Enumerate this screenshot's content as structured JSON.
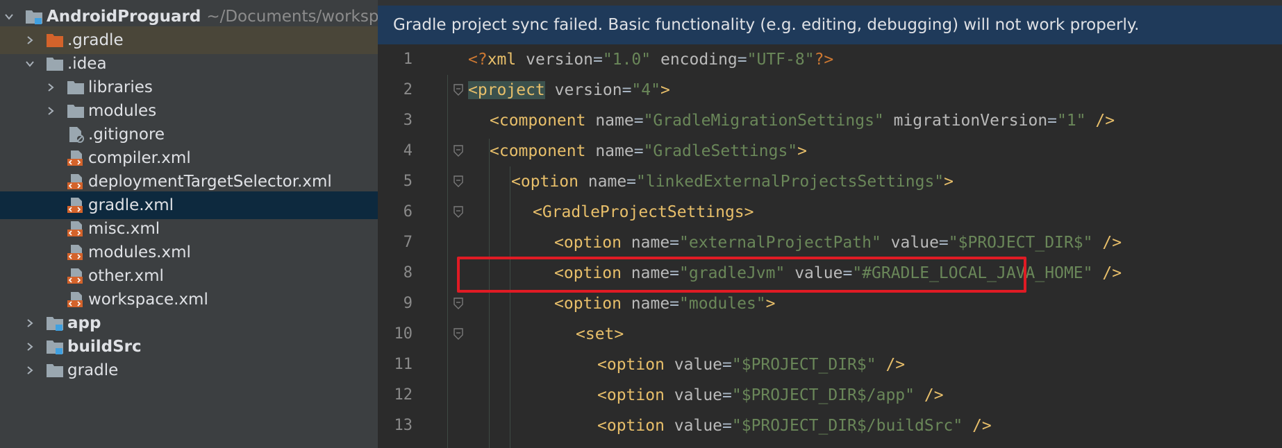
{
  "sidebar": {
    "items": [
      {
        "label": "AndroidProguard",
        "path": "~/Documents/worksp",
        "icon": "project-folder-icon",
        "arrow": "chevron-down-icon"
      },
      {
        "label": ".gradle",
        "icon": "orange-folder-icon",
        "arrow": "chevron-right-icon"
      },
      {
        "label": ".idea",
        "icon": "folder-icon",
        "arrow": "chevron-down-icon"
      },
      {
        "label": "libraries",
        "icon": "folder-icon",
        "arrow": "chevron-right-icon"
      },
      {
        "label": "modules",
        "icon": "folder-icon",
        "arrow": "chevron-right-icon"
      },
      {
        "label": ".gitignore",
        "icon": "ignored-file-icon"
      },
      {
        "label": "compiler.xml",
        "icon": "xml-file-icon"
      },
      {
        "label": "deploymentTargetSelector.xml",
        "icon": "xml-file-icon"
      },
      {
        "label": "gradle.xml",
        "icon": "xml-file-icon"
      },
      {
        "label": "misc.xml",
        "icon": "xml-file-icon"
      },
      {
        "label": "modules.xml",
        "icon": "xml-file-icon"
      },
      {
        "label": "other.xml",
        "icon": "xml-file-icon"
      },
      {
        "label": "workspace.xml",
        "icon": "xml-file-icon"
      },
      {
        "label": "app",
        "icon": "module-folder-icon",
        "arrow": "chevron-right-icon"
      },
      {
        "label": "buildSrc",
        "icon": "module-folder-icon",
        "arrow": "chevron-right-icon"
      },
      {
        "label": "gradle",
        "icon": "folder-icon",
        "arrow": "chevron-right-icon"
      }
    ]
  },
  "editor": {
    "banner": "Gradle project sync failed. Basic functionality (e.g. editing, debugging) will not work properly.",
    "lines": [
      {
        "num": "1",
        "tokens": [
          [
            "pi",
            "<?"
          ],
          [
            "tg",
            "xml "
          ],
          [
            "at",
            "version"
          ],
          [
            "tx",
            "="
          ],
          [
            "va",
            "\"1.0\""
          ],
          [
            "at",
            " encoding"
          ],
          [
            "tx",
            "="
          ],
          [
            "va",
            "\"UTF-8\""
          ],
          [
            "pi",
            "?>"
          ]
        ]
      },
      {
        "num": "2",
        "tokens": [
          [
            "tgh",
            "<project"
          ],
          [
            "at",
            " version"
          ],
          [
            "tx",
            "="
          ],
          [
            "va",
            "\"4\""
          ],
          [
            "tg",
            ">"
          ]
        ]
      },
      {
        "num": "3",
        "tokens": [
          [
            "tg",
            "<component "
          ],
          [
            "at",
            "name"
          ],
          [
            "tx",
            "="
          ],
          [
            "va",
            "\"GradleMigrationSettings\""
          ],
          [
            "at",
            " migrationVersion"
          ],
          [
            "tx",
            "="
          ],
          [
            "va",
            "\"1\""
          ],
          [
            "tg",
            " />"
          ]
        ]
      },
      {
        "num": "4",
        "tokens": [
          [
            "tg",
            "<component "
          ],
          [
            "at",
            "name"
          ],
          [
            "tx",
            "="
          ],
          [
            "va",
            "\"GradleSettings\""
          ],
          [
            "tg",
            ">"
          ]
        ]
      },
      {
        "num": "5",
        "tokens": [
          [
            "tg",
            "<option "
          ],
          [
            "at",
            "name"
          ],
          [
            "tx",
            "="
          ],
          [
            "va",
            "\"linkedExternalProjectsSettings\""
          ],
          [
            "tg",
            ">"
          ]
        ]
      },
      {
        "num": "6",
        "tokens": [
          [
            "tg",
            "<GradleProjectSettings>"
          ]
        ]
      },
      {
        "num": "7",
        "tokens": [
          [
            "tg",
            "<option "
          ],
          [
            "at",
            "name"
          ],
          [
            "tx",
            "="
          ],
          [
            "va",
            "\"externalProjectPath\""
          ],
          [
            "at",
            " value"
          ],
          [
            "tx",
            "="
          ],
          [
            "va",
            "\"$PROJECT_DIR$\""
          ],
          [
            "tg",
            " />"
          ]
        ]
      },
      {
        "num": "8",
        "tokens": [
          [
            "tg",
            "<option "
          ],
          [
            "at",
            "name"
          ],
          [
            "tx",
            "="
          ],
          [
            "va",
            "\"gradleJvm\""
          ],
          [
            "at",
            " value"
          ],
          [
            "tx",
            "="
          ],
          [
            "va",
            "\"#GRADLE_LOCAL_JAVA_HOME\""
          ],
          [
            "tg",
            " />"
          ]
        ]
      },
      {
        "num": "9",
        "tokens": [
          [
            "tg",
            "<option "
          ],
          [
            "at",
            "name"
          ],
          [
            "tx",
            "="
          ],
          [
            "va",
            "\"modules\""
          ],
          [
            "tg",
            ">"
          ]
        ]
      },
      {
        "num": "10",
        "tokens": [
          [
            "tg",
            "<set>"
          ]
        ]
      },
      {
        "num": "11",
        "tokens": [
          [
            "tg",
            "<option "
          ],
          [
            "at",
            "value"
          ],
          [
            "tx",
            "="
          ],
          [
            "va",
            "\"$PROJECT_DIR$\""
          ],
          [
            "tg",
            " />"
          ]
        ]
      },
      {
        "num": "12",
        "tokens": [
          [
            "tg",
            "<option "
          ],
          [
            "at",
            "value"
          ],
          [
            "tx",
            "="
          ],
          [
            "va",
            "\"$PROJECT_DIR$/app\""
          ],
          [
            "tg",
            " />"
          ]
        ]
      },
      {
        "num": "13",
        "tokens": [
          [
            "tg",
            "<option "
          ],
          [
            "at",
            "value"
          ],
          [
            "tx",
            "="
          ],
          [
            "va",
            "\"$PROJECT_DIR$/buildSrc\""
          ],
          [
            "tg",
            " />"
          ]
        ]
      }
    ]
  },
  "colors": {
    "sidebar_bg": "#3c3f41",
    "editor_bg": "#2b2b2b",
    "banner_bg": "#1f3a5a",
    "selected_row": "#0d293e",
    "tag": "#e8bf6a",
    "attribute": "#bababa",
    "value": "#6a8759",
    "highlight_box": "#e01b24"
  }
}
